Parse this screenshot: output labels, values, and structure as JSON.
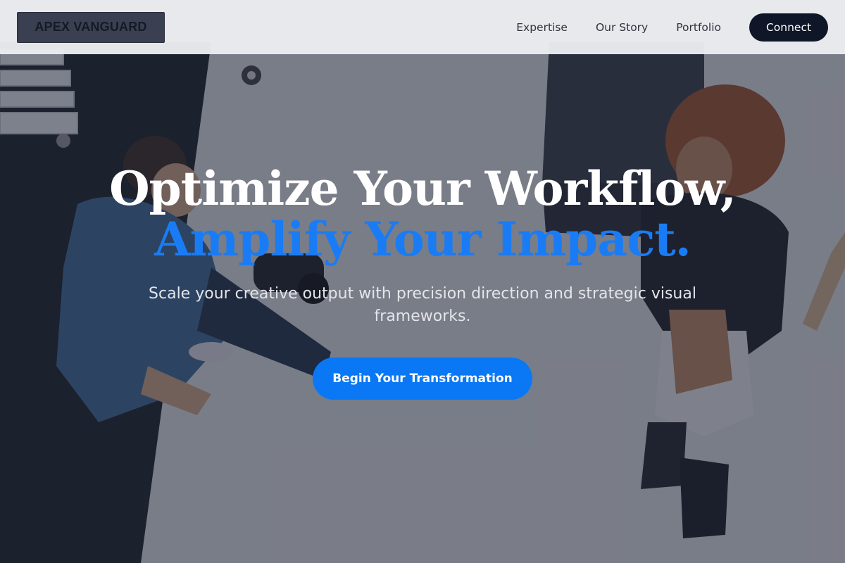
{
  "brand": {
    "logo_text": "APEX VANGUARD"
  },
  "nav": {
    "links": [
      "Expertise",
      "Our Story",
      "Portfolio"
    ],
    "connect_label": "Connect"
  },
  "hero": {
    "headline_line1": "Optimize Your Workflow,",
    "headline_line2": "Amplify Your Impact.",
    "subtitle": "Scale your creative output with precision direction and strategic visual frameworks.",
    "cta_label": "Begin Your Transformation",
    "background_image": "photographer-shooting-model-studio-photo"
  },
  "colors": {
    "accent": "#0a78f5",
    "headline_accent": "#1a7cf5",
    "nav_background": "#ecedf0",
    "connect_button": "#0f1628",
    "overlay": "#1e2234"
  }
}
